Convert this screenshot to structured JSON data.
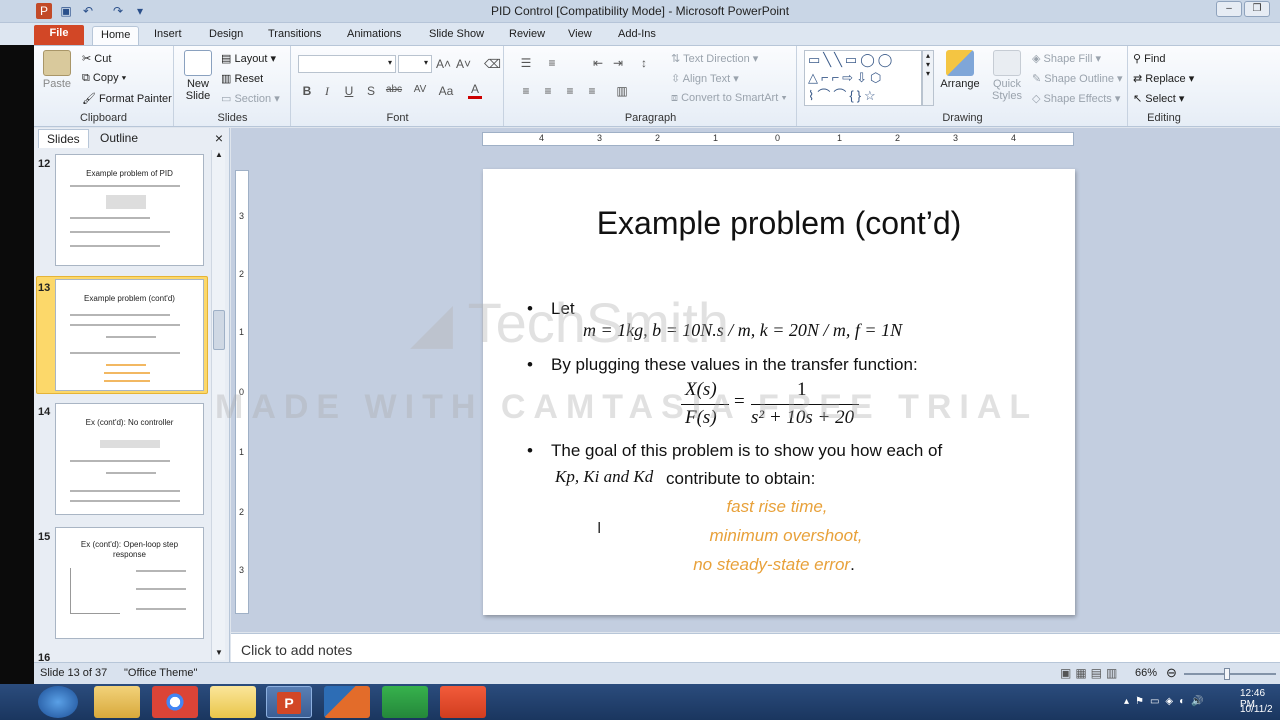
{
  "window": {
    "title": "PID Control [Compatibility Mode] - Microsoft PowerPoint"
  },
  "tabs": [
    "File",
    "Home",
    "Insert",
    "Design",
    "Transitions",
    "Animations",
    "Slide Show",
    "Review",
    "View",
    "Add-Ins"
  ],
  "ribbon": {
    "clipboard": {
      "paste": "Paste",
      "cut": "Cut",
      "copy": "Copy",
      "format_painter": "Format Painter",
      "label": "Clipboard"
    },
    "slides": {
      "new_slide": "New Slide",
      "layout": "Layout",
      "reset": "Reset",
      "section": "Section",
      "label": "Slides"
    },
    "font": {
      "label": "Font",
      "bold": "B",
      "italic": "I",
      "underline": "U",
      "shadow": "S",
      "strike": "abc",
      "spacing": "AV",
      "case": "Aa",
      "color": "A"
    },
    "paragraph": {
      "text_direction": "Text Direction",
      "align_text": "Align Text",
      "convert_smartart": "Convert to SmartArt",
      "label": "Paragraph"
    },
    "drawing": {
      "arrange": "Arrange",
      "quick_styles": "Quick Styles",
      "shape_fill": "Shape Fill",
      "shape_outline": "Shape Outline",
      "shape_effects": "Shape Effects",
      "label": "Drawing"
    },
    "editing": {
      "find": "Find",
      "replace": "Replace",
      "select": "Select",
      "label": "Editing"
    }
  },
  "left_panel": {
    "tabs": [
      "Slides",
      "Outline"
    ],
    "close": "×",
    "thumbnails": [
      {
        "num": "12",
        "title": "Example problem of PID"
      },
      {
        "num": "13",
        "title": "Example problem (cont'd)"
      },
      {
        "num": "14",
        "title": "Ex (cont'd): No controller"
      },
      {
        "num": "15",
        "title": "Ex (cont'd): Open-loop step response"
      },
      {
        "num": "16",
        "title": ""
      }
    ]
  },
  "ruler": {
    "h_ticks": [
      "4",
      "3",
      "2",
      "1",
      "0",
      "1",
      "2",
      "3",
      "4"
    ],
    "v_ticks": [
      "3",
      "2",
      "1",
      "0",
      "1",
      "2",
      "3"
    ]
  },
  "slide": {
    "title": "Example problem (cont’d)",
    "bullet1": "Let",
    "eq1": "m = 1kg,  b = 10N.s / m,  k = 20N / m,  f = 1N",
    "bullet2": "By plugging these values in the transfer function:",
    "eq2_num": "X(s)",
    "eq2_den": "F(s)",
    "eq2_rhs_num": "1",
    "eq2_rhs_den": "s² + 10s + 20",
    "bullet3": "The goal of this problem is to show you how each of",
    "bullet3_vars": "Kp, Ki and Kd",
    "bullet3_cont": "contribute to obtain:",
    "goal1": "fast rise time,",
    "goal2": "minimum overshoot,",
    "goal3": "no steady-state error",
    "goal3_end": "."
  },
  "watermark": {
    "logo": "TechSmith",
    "text": "MADE WITH CAMTASIA FREE TRIAL"
  },
  "notes": {
    "placeholder": "Click to add notes"
  },
  "status": {
    "slide": "Slide 13 of 37",
    "theme": "\"Office Theme\"",
    "zoom": "66%"
  },
  "taskbar": {
    "time": "12:46 PM",
    "date": "10/11/2"
  }
}
